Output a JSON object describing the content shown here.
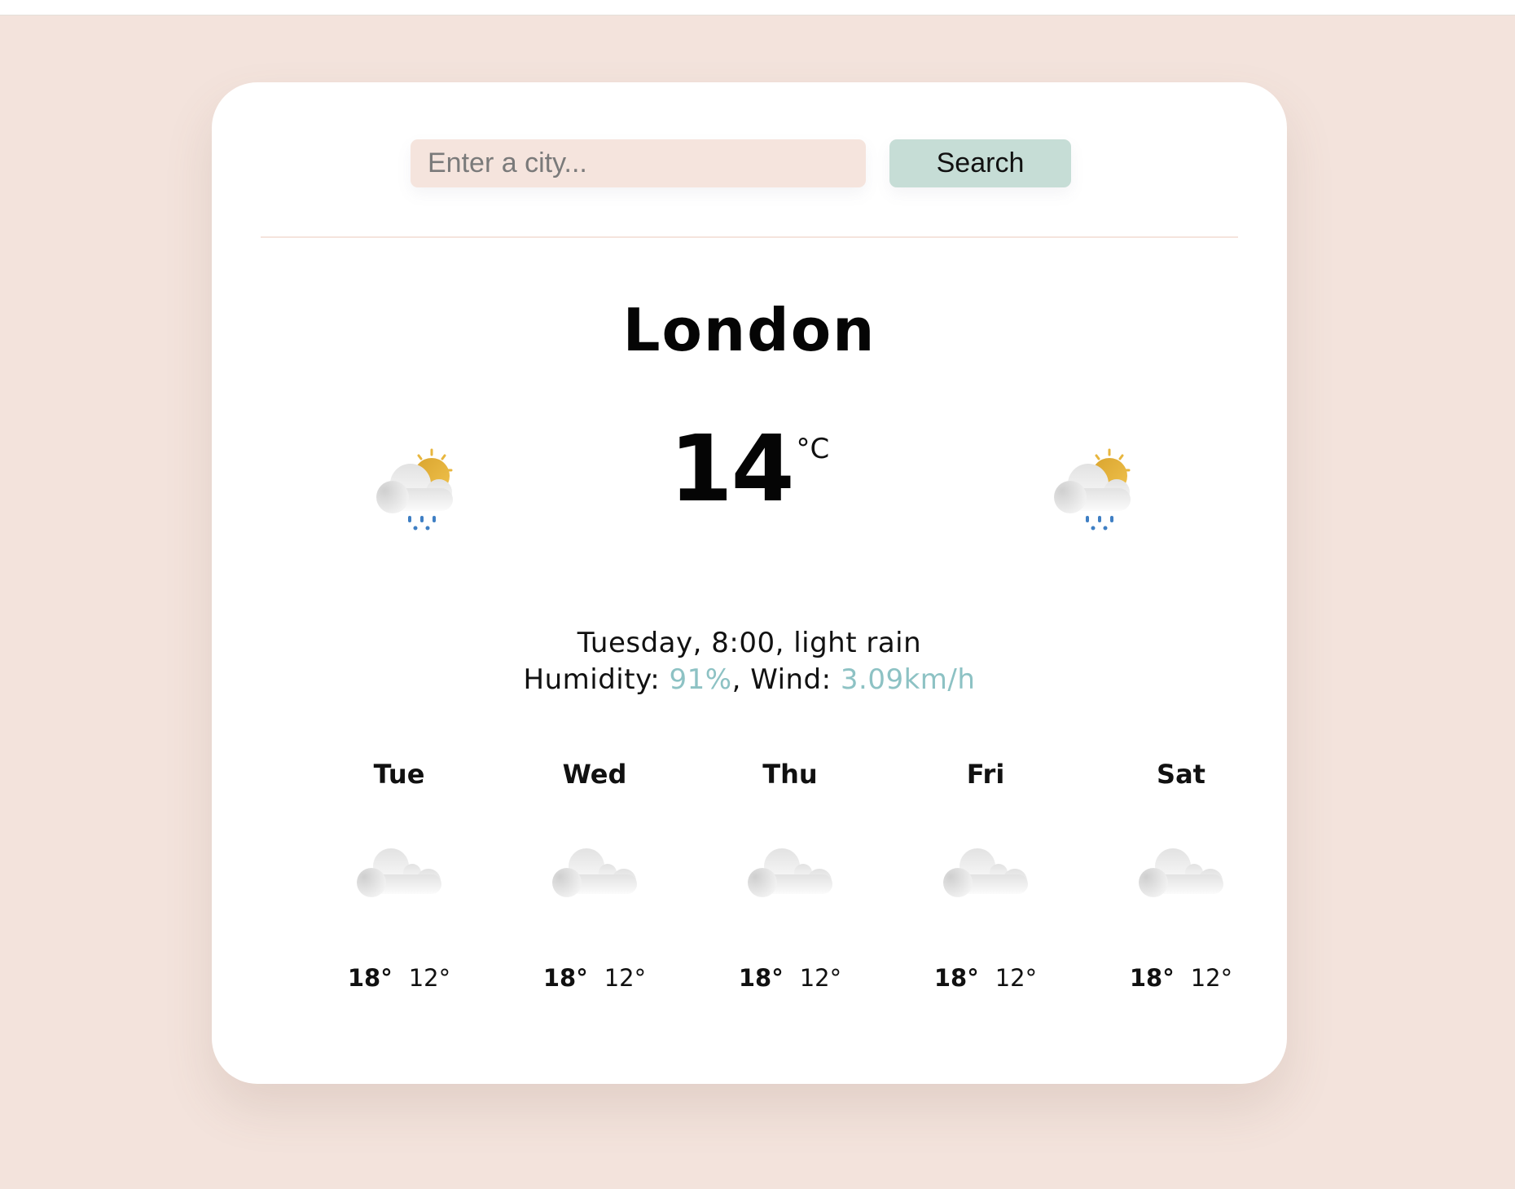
{
  "search": {
    "placeholder": "Enter a city...",
    "value": "",
    "button_label": "Search"
  },
  "current": {
    "city": "London",
    "temperature": "14",
    "unit": "°C",
    "icon": "partly-cloudy-rain-icon",
    "day_time": "Tuesday, 8:00",
    "condition": "light rain",
    "description_line": "Tuesday, 8:00, light rain",
    "humidity_label": "Humidity: ",
    "humidity": "91%",
    "wind_label": ", Wind: ",
    "wind": "3.09km/h"
  },
  "forecast": [
    {
      "day": "Tue",
      "icon": "cloud-icon",
      "max": "18°",
      "min": "12°"
    },
    {
      "day": "Wed",
      "icon": "cloud-icon",
      "max": "18°",
      "min": "12°"
    },
    {
      "day": "Thu",
      "icon": "cloud-icon",
      "max": "18°",
      "min": "12°"
    },
    {
      "day": "Fri",
      "icon": "cloud-icon",
      "max": "18°",
      "min": "12°"
    },
    {
      "day": "Sat",
      "icon": "cloud-icon",
      "max": "18°",
      "min": "12°"
    }
  ],
  "colors": {
    "background": "#f3e3dc",
    "card": "#ffffff",
    "input_bg": "#f5e4dd",
    "button_bg": "#c6ddd6",
    "accent": "#8dc2c4",
    "sun": "#e8b63e",
    "rain": "#3f7fc4"
  }
}
